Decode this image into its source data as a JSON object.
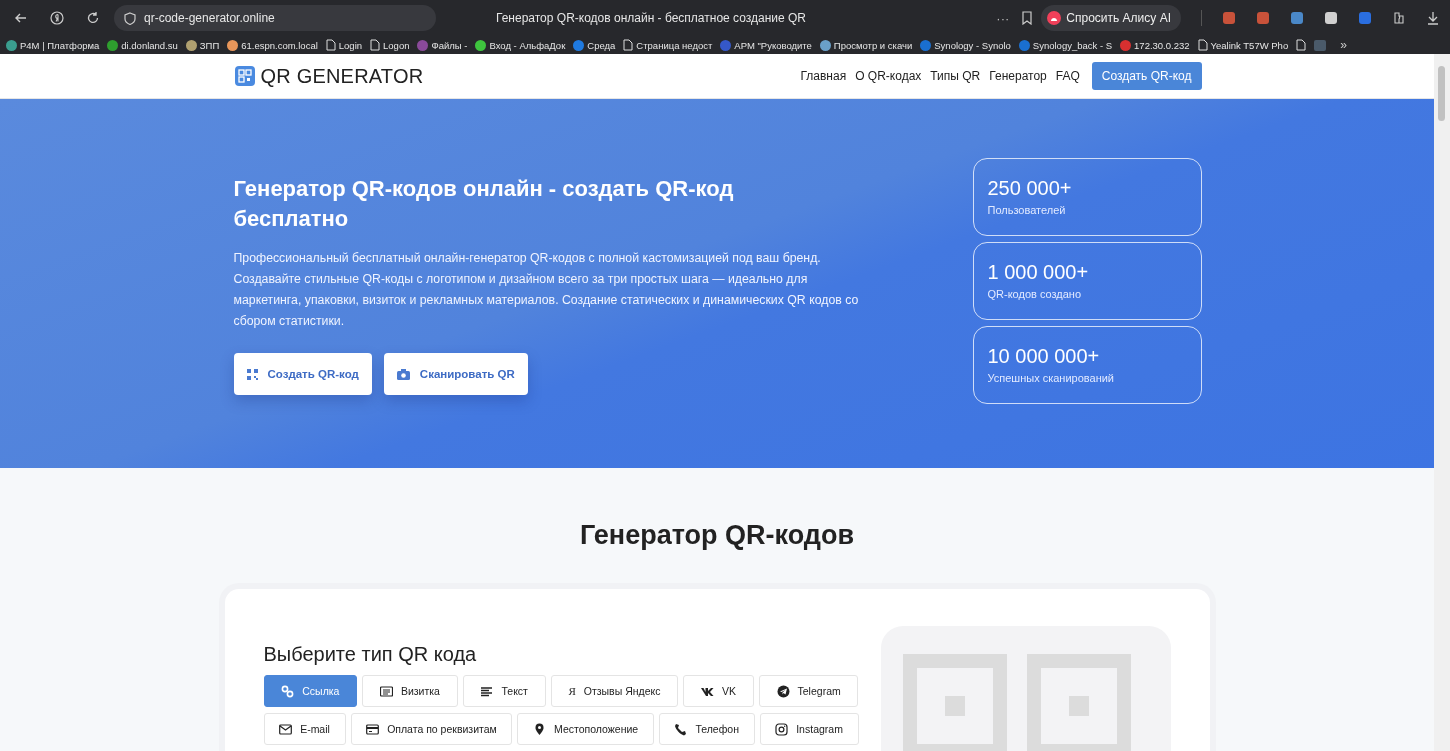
{
  "browser": {
    "url": "qr-code-generator.online",
    "title": "Генератор QR-кодов онлайн - бесплатное создание QR",
    "alice": "Спросить Алису AI",
    "more": "···",
    "overflow": "»"
  },
  "bookmarks": [
    {
      "label": "P4M | Платформа",
      "kind": "site",
      "color": "#3a9e8f"
    },
    {
      "label": "di.donland.su",
      "kind": "site",
      "color": "#2e9e2e"
    },
    {
      "label": "ЗПП",
      "kind": "site",
      "color": "#b0a070"
    },
    {
      "label": "61.espn.com.local",
      "kind": "site",
      "color": "#e8965a"
    },
    {
      "label": "Login",
      "kind": "page"
    },
    {
      "label": "Logon",
      "kind": "page"
    },
    {
      "label": "Файлы -",
      "kind": "site",
      "color": "#8a4a9a"
    },
    {
      "label": "Вход - АльфаДок",
      "kind": "site",
      "color": "#3ec43e"
    },
    {
      "label": "Среда",
      "kind": "site",
      "color": "#1f7ae0"
    },
    {
      "label": "Страница недост",
      "kind": "page"
    },
    {
      "label": "АРМ \"Руководите",
      "kind": "site",
      "color": "#3558c8"
    },
    {
      "label": "Просмотр и скачи",
      "kind": "site",
      "color": "#6aa0c8"
    },
    {
      "label": "Synology - Synolo",
      "kind": "site",
      "color": "#1a6fd0"
    },
    {
      "label": "Synology_back - S",
      "kind": "site",
      "color": "#1a6fd0"
    },
    {
      "label": "172.30.0.232",
      "kind": "site",
      "color": "#d83030"
    },
    {
      "label": "Yealink T57W Pho",
      "kind": "page"
    }
  ],
  "nav": {
    "logo": "QR GENERATOR",
    "links": [
      "Главная",
      "О QR-кодах",
      "Типы QR",
      "Генератор",
      "FAQ"
    ],
    "cta": "Создать QR-код"
  },
  "hero": {
    "title": "Генератор QR-кодов онлайн - создать QR-код бесплатно",
    "text": "Профессиональный бесплатный онлайн-генератор QR-кодов с полной кастомизацией под ваш бренд. Создавайте стильные QR-коды с логотипом и дизайном всего за три простых шага — идеально для маркетинга, упаковки, визиток и рекламных материалов. Создание статических и динамических QR кодов со сбором статистики.",
    "buttons": [
      {
        "label": "Создать QR-код",
        "kind": "qr"
      },
      {
        "label": "Сканировать QR",
        "kind": "camera"
      }
    ],
    "stats": [
      {
        "value": "250 000+",
        "label": "Пользователей"
      },
      {
        "value": "1 000 000+",
        "label": "QR-кодов создано"
      },
      {
        "value": "10 000 000+",
        "label": "Успешных сканирований"
      }
    ]
  },
  "generator": {
    "heading": "Генератор QR-кодов",
    "subheading": "Выберите тип QR кода",
    "type_rows": [
      [
        {
          "label": "Ссылка",
          "kind": "link",
          "selected": true
        },
        {
          "label": "Визитка",
          "kind": "card",
          "selected": false
        },
        {
          "label": "Текст",
          "kind": "text",
          "selected": false
        },
        {
          "label": "Отзывы Яндекс",
          "kind": "glyph",
          "glyph": "Я",
          "selected": false
        },
        {
          "label": "VK",
          "kind": "vk",
          "selected": false
        },
        {
          "label": "Telegram",
          "kind": "telegram",
          "selected": false
        }
      ],
      [
        {
          "label": "E-mail",
          "kind": "mail",
          "selected": false
        },
        {
          "label": "Оплата по реквизитам",
          "kind": "payment",
          "selected": false
        },
        {
          "label": "Местоположение",
          "kind": "pin",
          "selected": false
        },
        {
          "label": "Телефон",
          "kind": "phone",
          "selected": false
        },
        {
          "label": "Instagram",
          "kind": "instagram",
          "selected": false
        }
      ]
    ]
  }
}
